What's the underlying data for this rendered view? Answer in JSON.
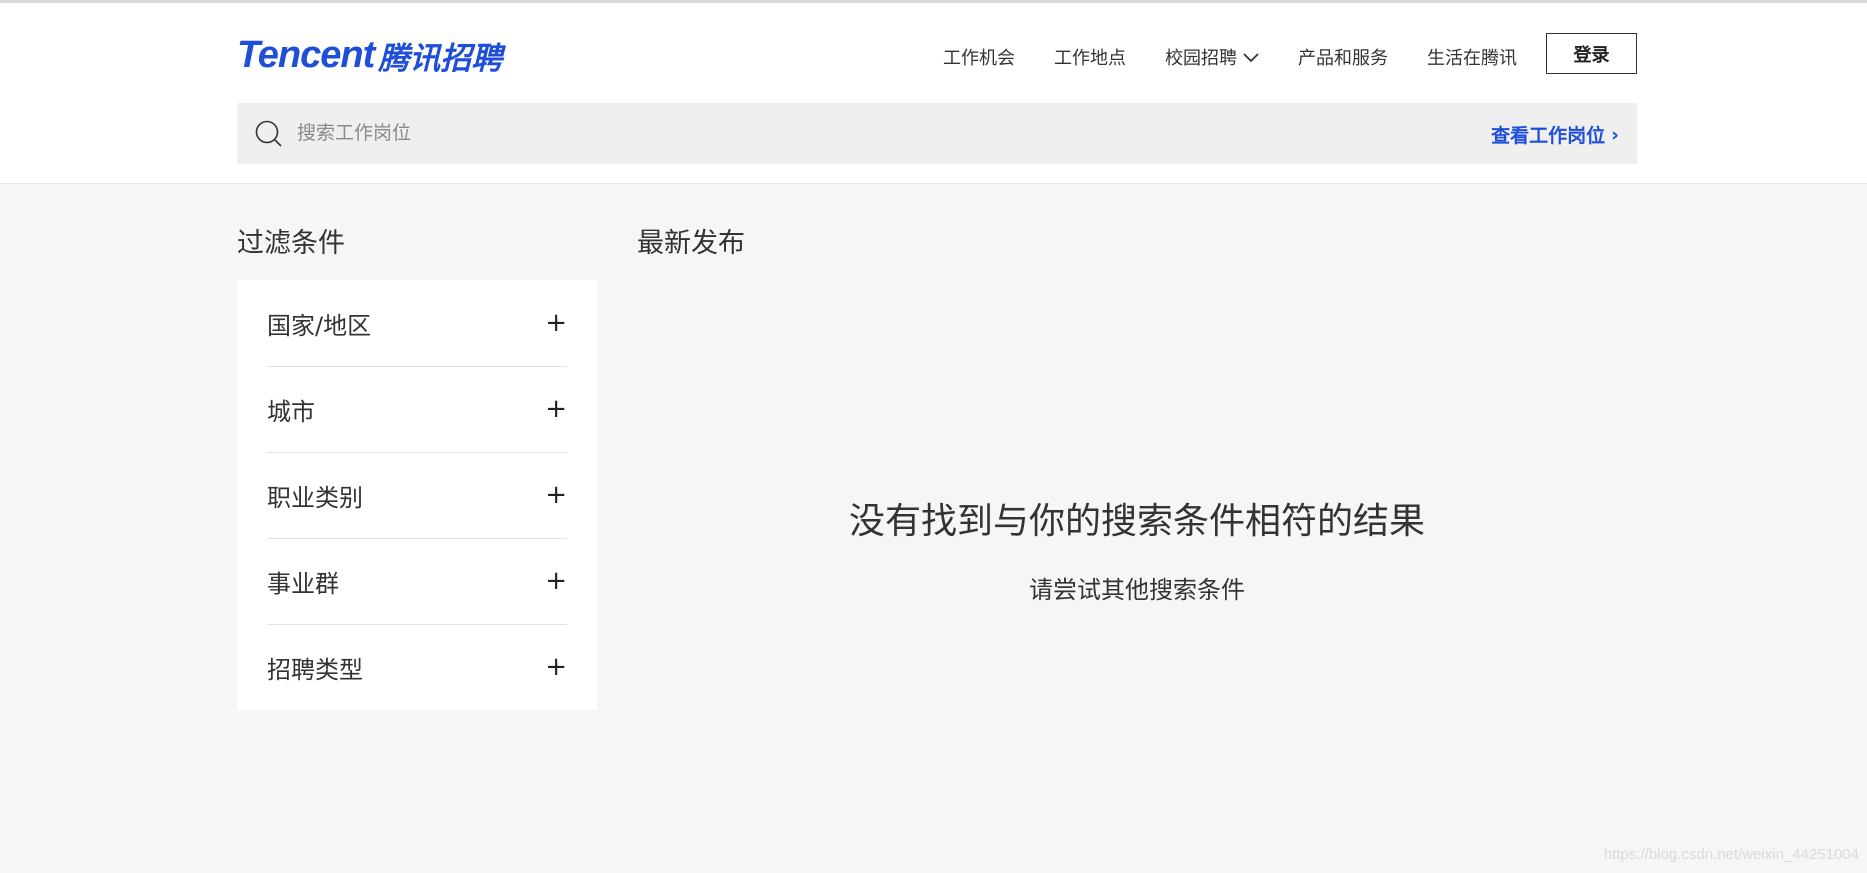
{
  "header": {
    "logo_en": "Tencent",
    "logo_cn": "腾讯招聘",
    "nav": [
      "工作机会",
      "工作地点",
      "校园招聘",
      "产品和服务",
      "生活在腾讯"
    ],
    "login_label": "登录"
  },
  "search": {
    "placeholder": "搜索工作岗位",
    "view_jobs_label": "查看工作岗位",
    "view_jobs_arrow": "›"
  },
  "filters": {
    "title": "过滤条件",
    "items": [
      {
        "label": "国家/地区",
        "icon": "+"
      },
      {
        "label": "城市",
        "icon": "+"
      },
      {
        "label": "职业类别",
        "icon": "+"
      },
      {
        "label": "事业群",
        "icon": "+"
      },
      {
        "label": "招聘类型",
        "icon": "+"
      }
    ]
  },
  "main": {
    "title": "最新发布",
    "empty_title": "没有找到与你的搜索条件相符的结果",
    "empty_subtitle": "请尝试其他搜索条件"
  },
  "watermark": "https://blog.csdn.net/weixin_44251004",
  "colors": {
    "brand_blue": "#1f4ed8",
    "page_bg": "#f6f6f6",
    "search_bg": "#efefef"
  }
}
